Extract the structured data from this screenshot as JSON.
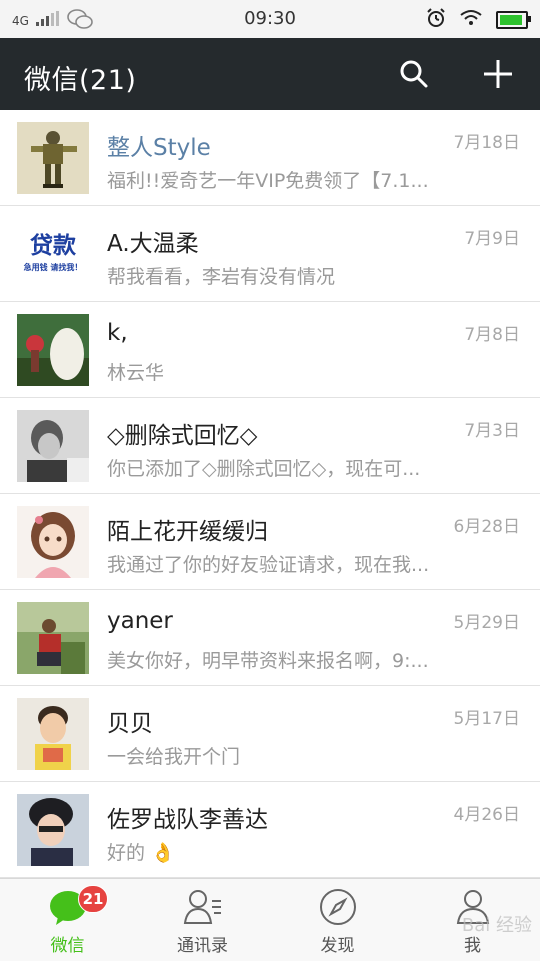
{
  "status_bar": {
    "network": "4G",
    "time": "09:30",
    "colors": {
      "battery": "#2dc22d"
    },
    "icons": [
      "signal-icon",
      "wechat-icon",
      "alarm-icon",
      "wifi-icon",
      "battery-icon"
    ]
  },
  "app_bar": {
    "title": "微信(21)",
    "icons": [
      "search-icon",
      "plus-icon"
    ],
    "colors": {
      "background": "#252a2d"
    }
  },
  "chats": [
    {
      "name": "整人Style",
      "date": "7月18日",
      "message": "福利!!爱奇艺一年VIP免费领了【7.1...",
      "avatar": "robot-avatar",
      "highlight": true
    },
    {
      "name": "A.大温柔",
      "date": "7月9日",
      "message": "帮我看看，李岩有没有情况",
      "avatar": "loan-ad-avatar",
      "avatar_text": {
        "title": "贷款",
        "sub": "急用钱 请找我！"
      }
    },
    {
      "name": "k,",
      "date": "7月8日",
      "message": "林云华",
      "avatar": "cartoon-avatar"
    },
    {
      "name": "◇删除式回忆◇",
      "date": "7月3日",
      "message": "你已添加了◇删除式回忆◇，现在可...",
      "avatar": "bw-photo-avatar"
    },
    {
      "name": "陌上花开缓缓归",
      "date": "6月28日",
      "message": "我通过了你的好友验证请求，现在我...",
      "avatar": "anime-girl-avatar"
    },
    {
      "name": "yaner",
      "date": "5月29日",
      "message": "美女你好，明早带资料来报名啊，9:...",
      "avatar": "outdoor-photo-avatar"
    },
    {
      "name": "贝贝",
      "date": "5月17日",
      "message": "一会给我开个门",
      "avatar": "child-photo-avatar"
    },
    {
      "name": "佐罗战队李善达",
      "date": "4月26日",
      "message": "好的 👌",
      "avatar": "boy-photo-avatar"
    }
  ],
  "tabs": [
    {
      "label": "微信",
      "icon": "chat-bubble-icon",
      "active": true,
      "badge": "21"
    },
    {
      "label": "通讯录",
      "icon": "contacts-icon",
      "active": false
    },
    {
      "label": "发现",
      "icon": "compass-icon",
      "active": false
    },
    {
      "label": "我",
      "icon": "person-icon",
      "active": false
    }
  ],
  "watermark": "Bai 经验"
}
